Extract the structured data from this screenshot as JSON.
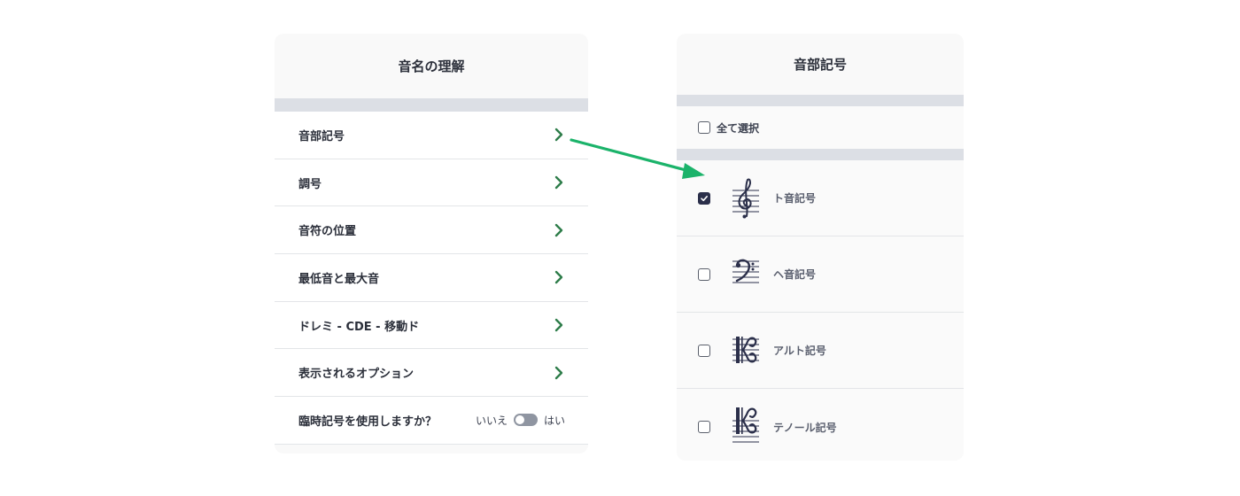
{
  "left_panel": {
    "title": "音名の理解",
    "items": [
      {
        "label": "音部記号"
      },
      {
        "label": "調号"
      },
      {
        "label": "音符の位置"
      },
      {
        "label": "最低音と最大音"
      },
      {
        "label": "ドレミ - CDE - 移動ド"
      },
      {
        "label": "表示されるオプション"
      }
    ],
    "accidentals": {
      "label": "臨時記号を使用しますか？",
      "off_label": "いいえ",
      "on_label": "はい",
      "value": "いいえ"
    }
  },
  "right_panel": {
    "title": "音部記号",
    "select_all": {
      "label": "全て選択",
      "checked": false
    },
    "clefs": [
      {
        "label": "ト音記号",
        "checked": true,
        "icon": "treble-clef-icon"
      },
      {
        "label": "ヘ音記号",
        "checked": false,
        "icon": "bass-clef-icon"
      },
      {
        "label": "アルト記号",
        "checked": false,
        "icon": "alto-clef-icon"
      },
      {
        "label": "テノール記号",
        "checked": false,
        "icon": "tenor-clef-icon"
      }
    ]
  },
  "colors": {
    "chevron": "#2e7d4a",
    "arrow": "#1bb36a",
    "checkbox_checked": "#2b2f4a",
    "divider_bar": "#dcdfe5"
  }
}
